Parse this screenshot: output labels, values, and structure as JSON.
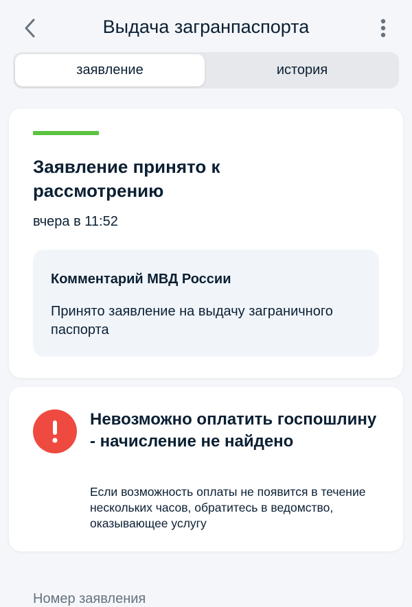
{
  "header": {
    "title": "Выдача загранпаспорта",
    "back_icon": "chevron-left-icon",
    "more_icon": "more-vertical-icon"
  },
  "tabs": [
    {
      "label": "заявление",
      "active": true
    },
    {
      "label": "история",
      "active": false
    }
  ],
  "status_card": {
    "title": "Заявление принято к рассмотрению",
    "date": "вчера в 11:52",
    "progress_color": "#5ac33f",
    "comment": {
      "title": "Комментарий МВД России",
      "text": "Принято заявление на выдачу заграничного паспорта"
    }
  },
  "alert_card": {
    "icon": "error-icon",
    "icon_color": "#ee4a3f",
    "title": "Невозможно оплатить госпошлину - начисление не найдено",
    "text": "Если возможность оплаты не появится в течение нескольких часов, обратитесь в ведомство, оказывающее услугу"
  },
  "details": {
    "application_number_label": "Номер заявления"
  }
}
